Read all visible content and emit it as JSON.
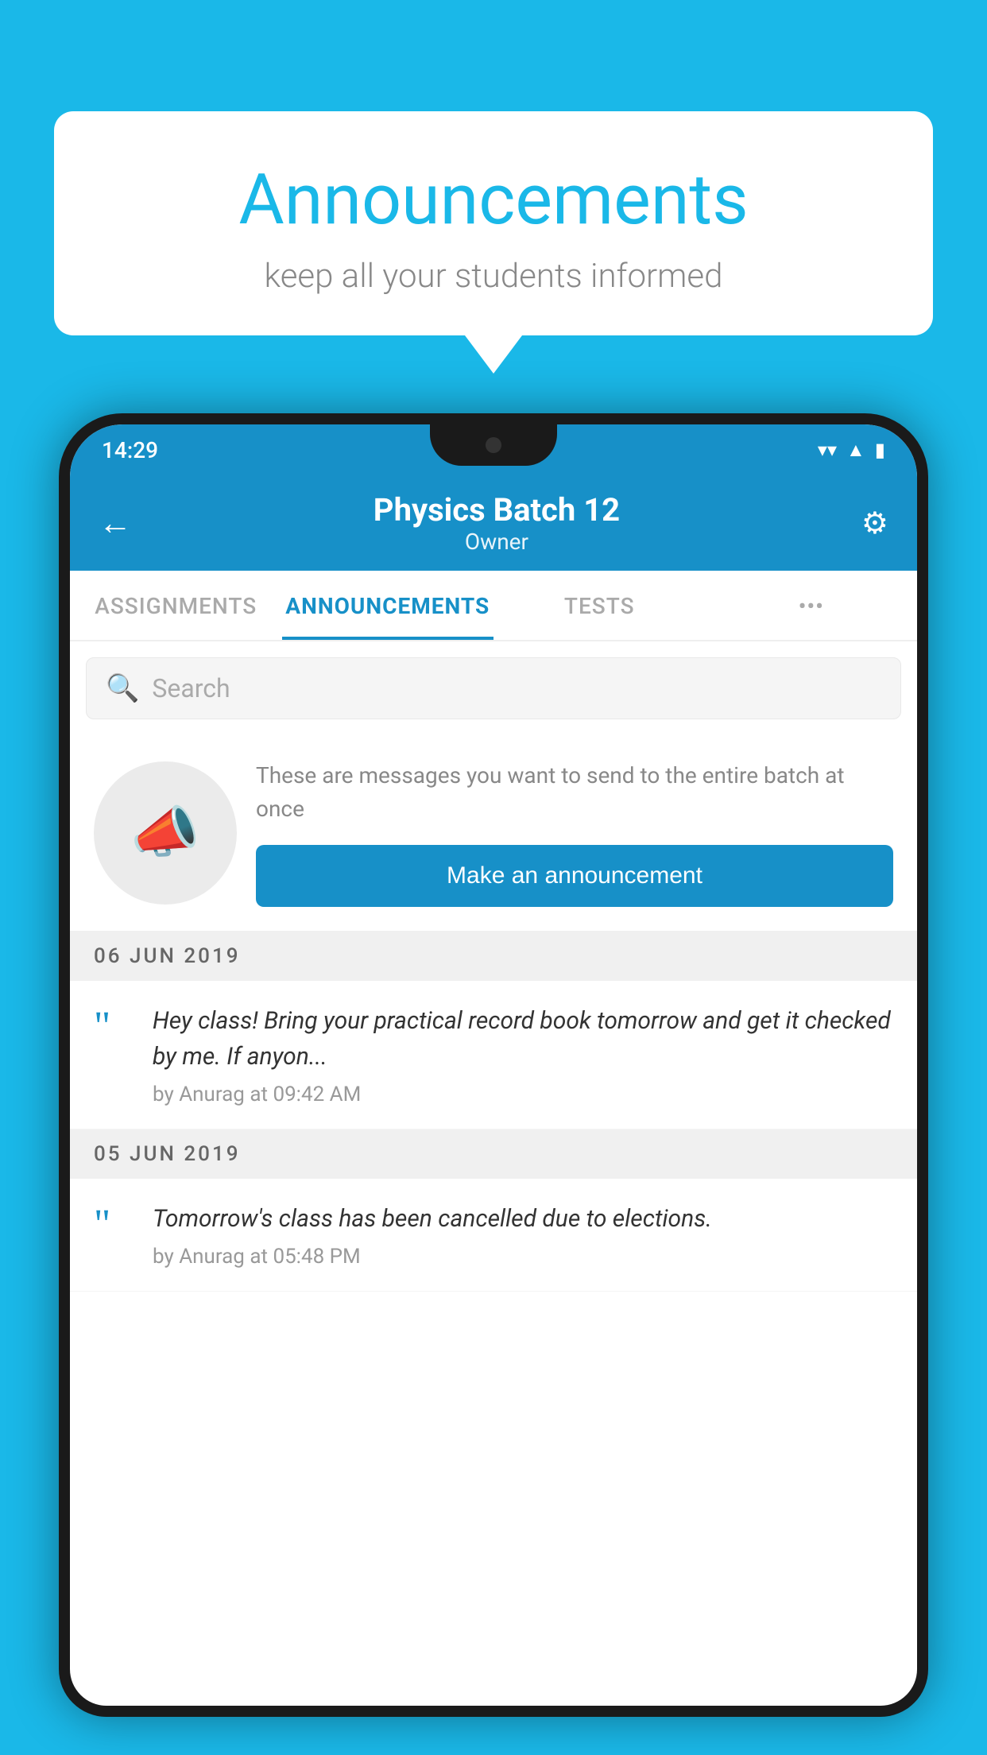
{
  "background_color": "#1ab8e8",
  "speech_bubble": {
    "title": "Announcements",
    "subtitle": "keep all your students informed"
  },
  "phone": {
    "status_bar": {
      "time": "14:29",
      "wifi": "▼",
      "signal": "▲",
      "battery": "▮"
    },
    "header": {
      "back_label": "←",
      "title": "Physics Batch 12",
      "subtitle": "Owner",
      "settings_label": "⚙"
    },
    "tabs": [
      {
        "label": "ASSIGNMENTS",
        "active": false
      },
      {
        "label": "ANNOUNCEMENTS",
        "active": true
      },
      {
        "label": "TESTS",
        "active": false
      },
      {
        "label": "•••",
        "active": false
      }
    ],
    "search": {
      "placeholder": "Search"
    },
    "promo": {
      "description": "These are messages you want to send to the entire batch at once",
      "button_label": "Make an announcement"
    },
    "announcements": [
      {
        "date": "06  JUN  2019",
        "text": "Hey class! Bring your practical record book tomorrow and get it checked by me. If anyon...",
        "meta": "by Anurag at 09:42 AM"
      },
      {
        "date": "05  JUN  2019",
        "text": "Tomorrow's class has been cancelled due to elections.",
        "meta": "by Anurag at 05:48 PM"
      }
    ]
  }
}
